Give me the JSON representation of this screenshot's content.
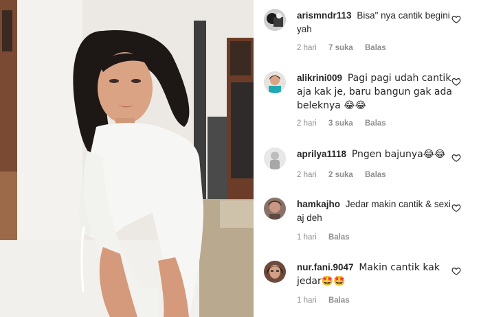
{
  "comments": [
    {
      "username": "arismndr113",
      "text": "Bisa\" nya cantik begini yah",
      "time": "2 hari",
      "likes": "7 suka",
      "reply": "Balas",
      "avatar": "avatar-dark"
    },
    {
      "username": "alikrini009",
      "text": "Pagi pagi udah cantik aja kak je, baru bangun gak ada beleknya 😂😂",
      "time": "2 hari",
      "likes": "3 suka",
      "reply": "Balas",
      "avatar": "avatar-teal"
    },
    {
      "username": "aprilya1118",
      "text": "Pngen bajunya😂😂",
      "time": "2 hari",
      "likes": "2 suka",
      "reply": "Balas",
      "avatar": "avatar-grey"
    },
    {
      "username": "hamkajho",
      "text": "Jedar makin cantik & sexi aj deh",
      "time": "1 hari",
      "likes": "",
      "reply": "Balas",
      "avatar": "avatar-brown"
    },
    {
      "username": "nur.fani.9047",
      "text": "Makin cantik kak jedar🤩🤩",
      "time": "1 hari",
      "likes": "",
      "reply": "Balas",
      "avatar": "avatar-dark-hair"
    }
  ],
  "icons": {
    "heart": "heart-outline-icon"
  },
  "colors": {
    "text": "#262626",
    "meta": "#8e8e8e"
  }
}
